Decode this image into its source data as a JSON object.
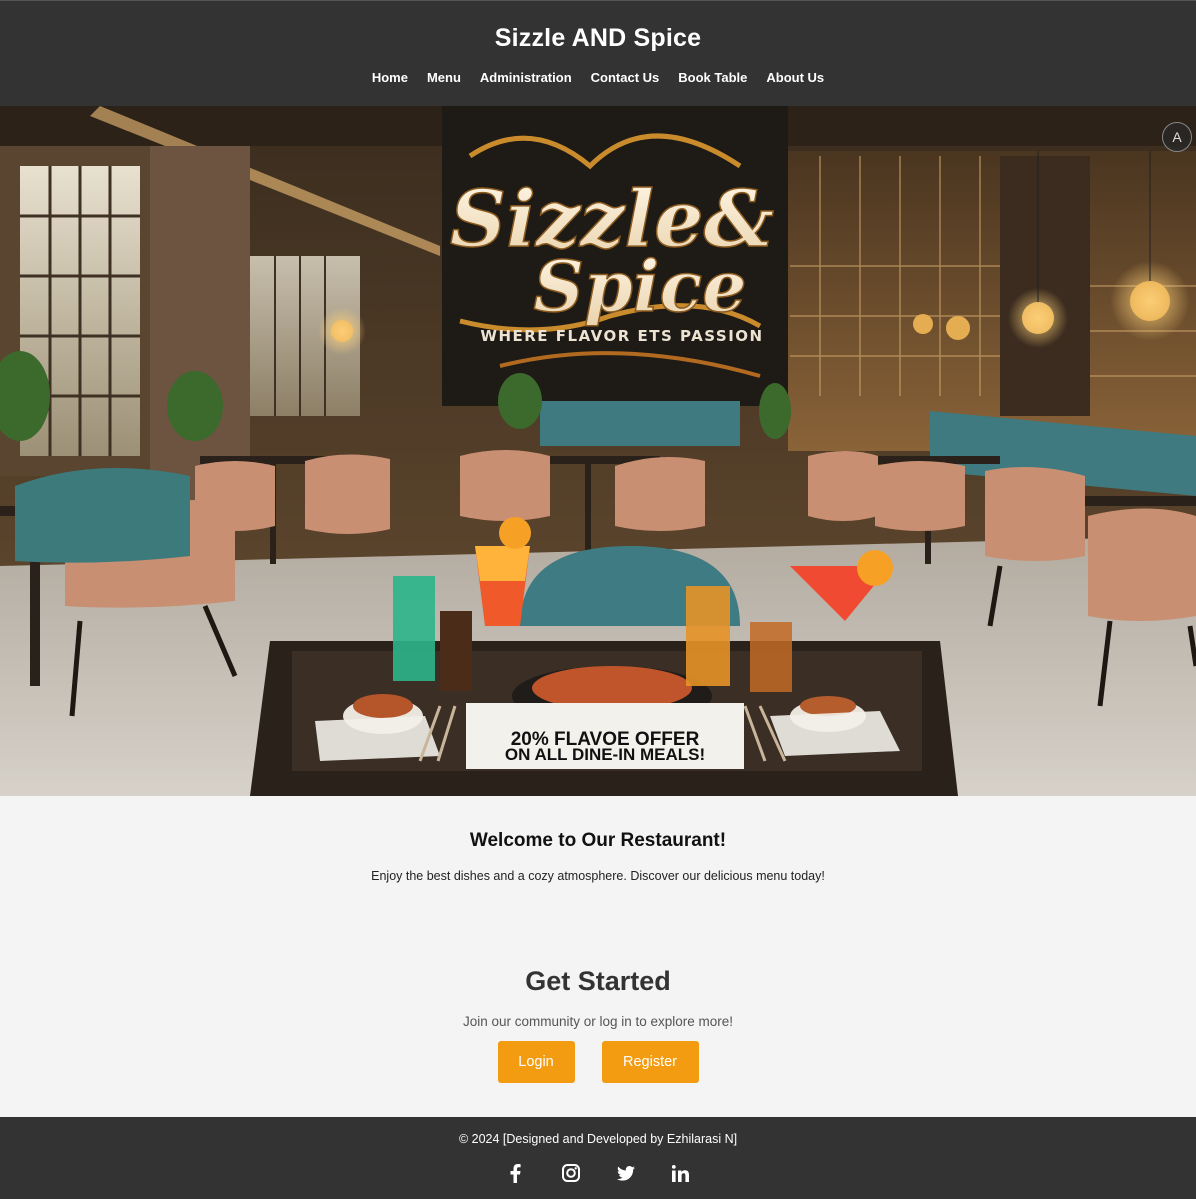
{
  "header": {
    "site_title": "Sizzle AND Spice",
    "nav": [
      "Home",
      "Menu",
      "Administration",
      "Contact Us",
      "Book Table",
      "About Us"
    ]
  },
  "hero": {
    "logo_line1": "Sizzle&",
    "logo_line2": "Spice",
    "tagline": "WHERE FLAVOR ETS PASSION",
    "offer_line1": "20% FLAVOE OFFER",
    "offer_line2": "ON ALL DINE-IN MEALS!",
    "translate_icon_glyph": "A"
  },
  "welcome": {
    "title": "Welcome to Our Restaurant!",
    "text": "Enjoy the best dishes and a cozy atmosphere. Discover our delicious menu today!"
  },
  "get_started": {
    "title": "Get Started",
    "subtitle": "Join our community or log in to explore more!",
    "login_label": "Login",
    "register_label": "Register"
  },
  "footer": {
    "copyright": "© 2024 [Designed and Developed by Ezhilarasi N]",
    "socials": [
      "facebook-icon",
      "instagram-icon",
      "twitter-icon",
      "linkedin-icon"
    ]
  },
  "colors": {
    "header_bg": "#333333",
    "button_bg": "#f39c12",
    "page_bg": "#f4f4f4"
  }
}
